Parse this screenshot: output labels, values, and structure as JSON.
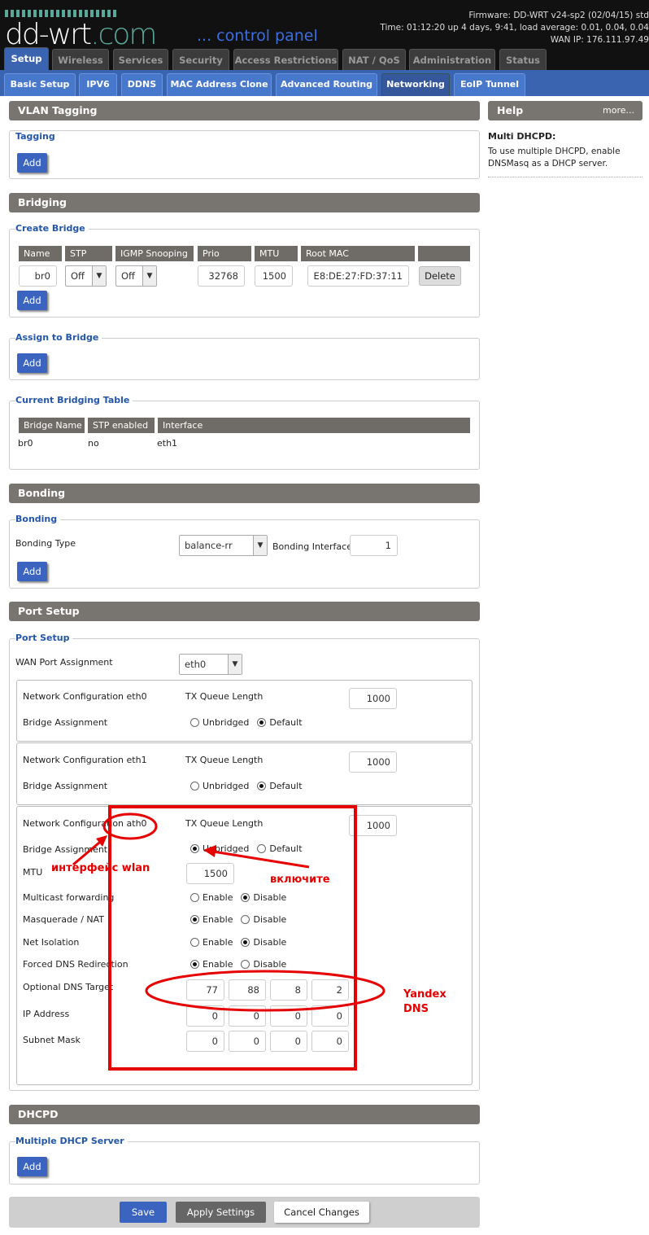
{
  "header": {
    "logo": "dd-wrt",
    "logo_suffix": ".com",
    "subtitle": "... control panel",
    "firmware": "Firmware: DD-WRT v24-sp2 (02/04/15) std",
    "time": "Time: 01:12:20 up 4 days, 9:41, load average: 0.01, 0.04, 0.04",
    "wan_ip": "WAN IP: 176.111.97.49"
  },
  "tabs": [
    "Setup",
    "Wireless",
    "Services",
    "Security",
    "Access Restrictions",
    "NAT / QoS",
    "Administration",
    "Status"
  ],
  "subtabs": [
    "Basic Setup",
    "IPV6",
    "DDNS",
    "MAC Address Clone",
    "Advanced Routing",
    "Networking",
    "EoIP Tunnel"
  ],
  "add_label": "Add",
  "vlan": {
    "title": "VLAN Tagging",
    "legend": "Tagging"
  },
  "bridging": {
    "title": "Bridging",
    "create_legend": "Create Bridge",
    "columns": [
      "Name",
      "STP",
      "IGMP Snooping",
      "Prio",
      "MTU",
      "Root MAC",
      ""
    ],
    "row": {
      "name": "br0",
      "stp": "Off",
      "igmp": "Off",
      "prio": "32768",
      "mtu": "1500",
      "mac": "E8:DE:27:FD:37:11",
      "delete": "Delete"
    },
    "assign_legend": "Assign to Bridge",
    "table_legend": "Current Bridging Table",
    "table_columns": [
      "Bridge Name",
      "STP enabled",
      "Interface"
    ],
    "table_rows": [
      [
        "br0",
        "no",
        "eth1"
      ]
    ]
  },
  "bonding": {
    "title": "Bonding",
    "legend": "Bonding",
    "type_label": "Bonding Type",
    "type_value": "balance-rr",
    "ifaces_label": "Bonding Interfaces",
    "ifaces_value": "1"
  },
  "port": {
    "title": "Port Setup",
    "legend": "Port Setup",
    "wan_label": "WAN Port Assignment",
    "wan_value": "eth0",
    "netconf_label": "Network Configuration",
    "tx_label": "TX Queue Length",
    "bridge_label": "Bridge Assignment",
    "unbridged": "Unbridged",
    "default": "Default",
    "enable": "Enable",
    "disable": "Disable",
    "ifaces": [
      {
        "name": "eth0",
        "tx": "1000",
        "bridge": "default"
      },
      {
        "name": "eth1",
        "tx": "1000",
        "bridge": "default"
      }
    ],
    "ath0": {
      "name": "ath0",
      "tx": "1000",
      "mtu_label": "MTU",
      "mtu": "1500",
      "multicast_label": "Multicast forwarding",
      "masq_label": "Masquerade / NAT",
      "iso_label": "Net Isolation",
      "dns_redir_label": "Forced DNS Redirection",
      "dns_target_label": "Optional DNS Target",
      "dns_target": [
        "77",
        "88",
        "8",
        "2"
      ],
      "ip_label": "IP Address",
      "ip": [
        "0",
        "0",
        "0",
        "0"
      ],
      "mask_label": "Subnet Mask",
      "mask": [
        "0",
        "0",
        "0",
        "0"
      ]
    }
  },
  "dhcpd": {
    "title": "DHCPD",
    "legend": "Multiple DHCP Server"
  },
  "footer": {
    "save": "Save",
    "apply": "Apply Settings",
    "cancel": "Cancel Changes"
  },
  "help": {
    "title": "Help",
    "more": "more...",
    "heading": "Multi DHCPD:",
    "text1": "To use multiple DHCPD, enable",
    "text2": "DNSMasq as a DHCP server."
  },
  "annotations": {
    "wlan": "интерфейс wlan",
    "enable": "включите",
    "yandex1": "Yandex",
    "yandex2": "DNS"
  },
  "colors": {
    "accent": "#3b64c0",
    "annotation": "#e60000"
  }
}
